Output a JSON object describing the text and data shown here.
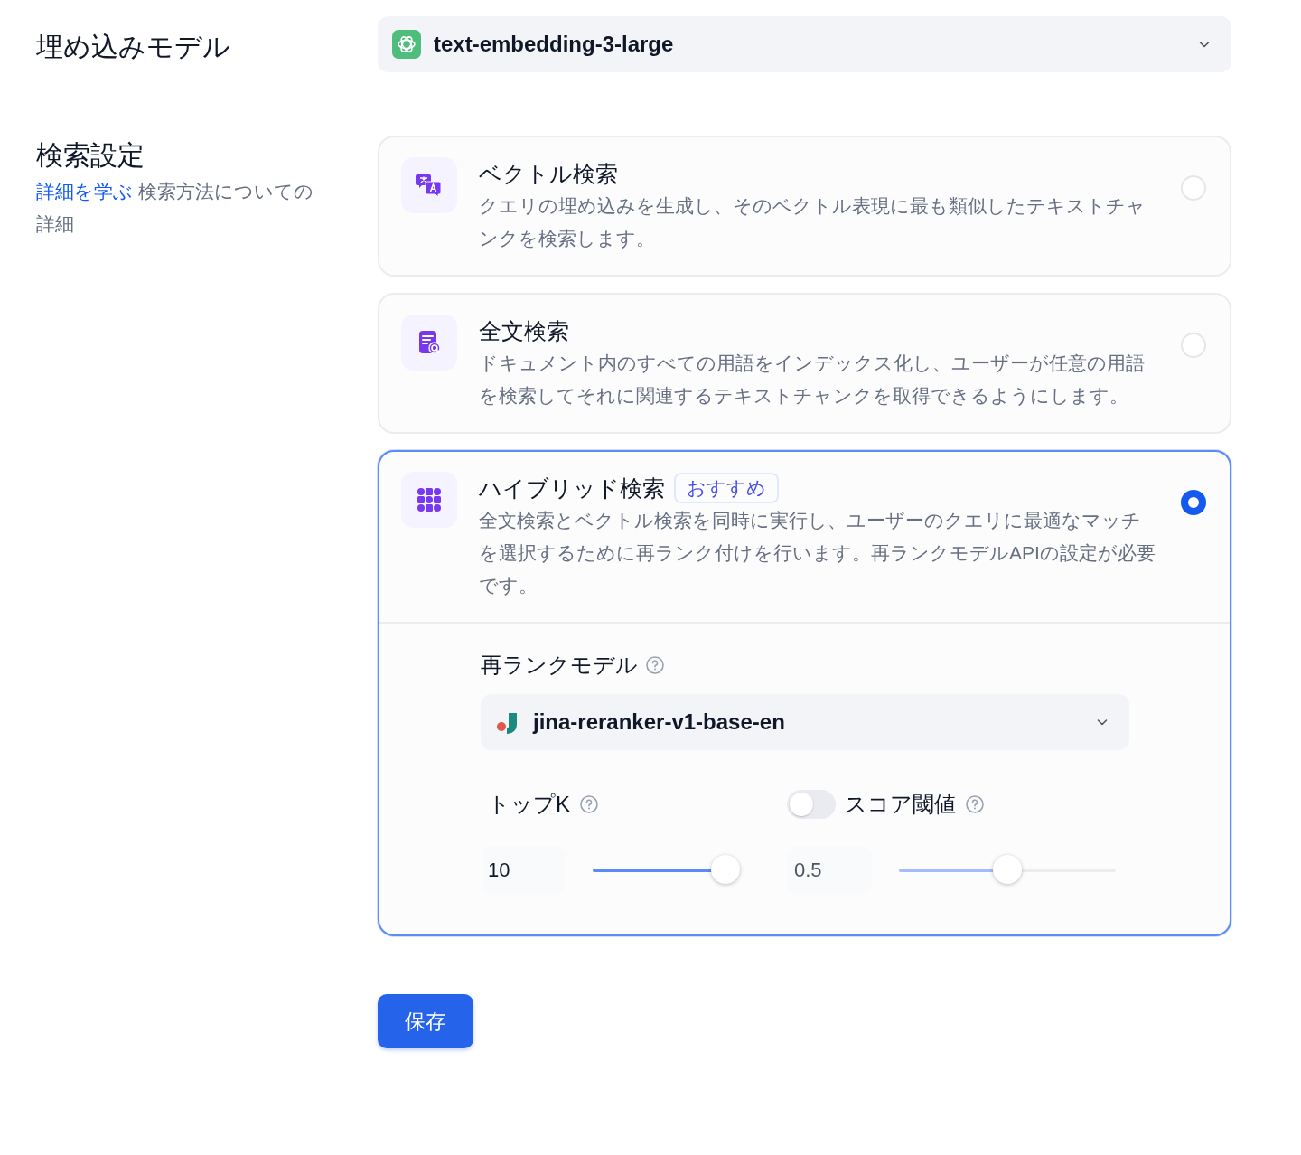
{
  "embedding_model": {
    "label": "埋め込みモデル",
    "value": "text-embedding-3-large"
  },
  "retrieval": {
    "label": "検索設定",
    "learn_more": "詳細を学ぶ",
    "description": "検索方法についての詳細",
    "options": [
      {
        "kind": "vector",
        "title": "ベクトル検索",
        "description": "クエリの埋め込みを生成し、そのベクトル表現に最も類似したテキストチャンクを検索します。",
        "selected": false
      },
      {
        "kind": "fulltext",
        "title": "全文検索",
        "description": "ドキュメント内のすべての用語をインデックス化し、ユーザーが任意の用語を検索してそれに関連するテキストチャンクを取得できるようにします。",
        "selected": false
      },
      {
        "kind": "hybrid",
        "title": "ハイブリッド検索",
        "badge": "おすすめ",
        "description": "全文検索とベクトル検索を同時に実行し、ユーザーのクエリに最適なマッチを選択するために再ランク付けを行います。再ランクモデルAPIの設定が必要です。",
        "selected": true
      }
    ]
  },
  "rerank": {
    "label": "再ランクモデル",
    "model": "jina-reranker-v1-base-en"
  },
  "top_k": {
    "label": "トップK",
    "value": "10",
    "level": 0.9
  },
  "score_threshold": {
    "label": "スコア閾値",
    "on": false,
    "value": "0.5",
    "level": 0.5
  },
  "save": "保存"
}
